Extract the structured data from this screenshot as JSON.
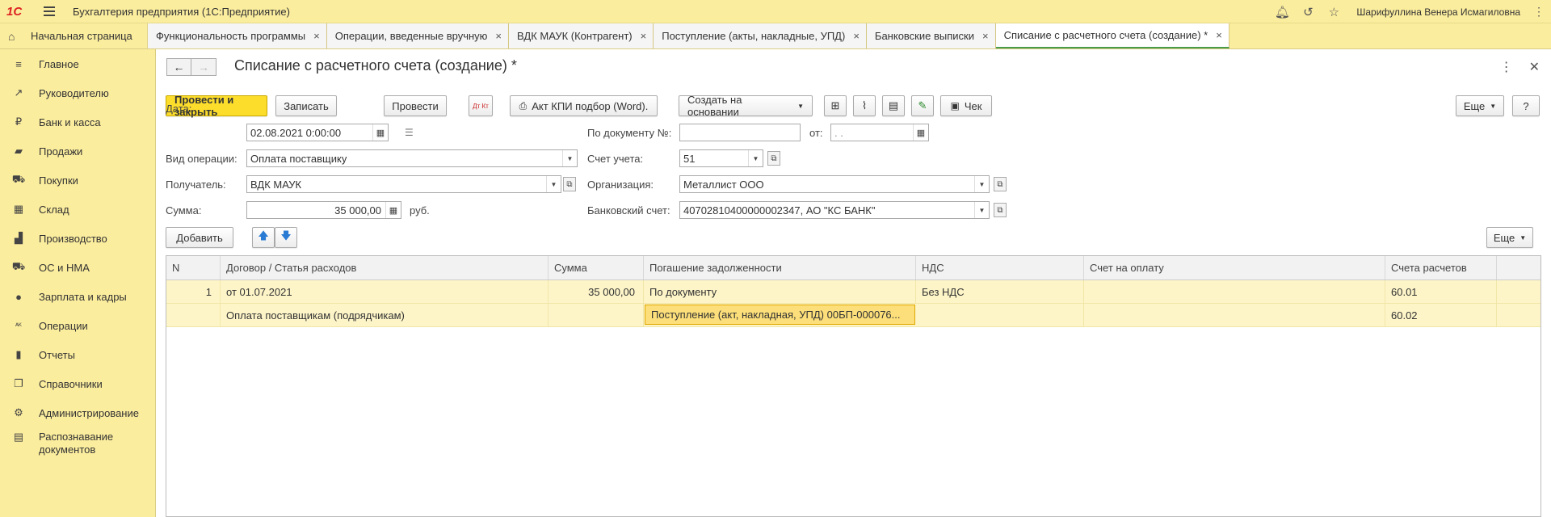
{
  "app": {
    "title": "Бухгалтерия предприятия  (1С:Предприятие)",
    "logo": "1С",
    "user": "Шарифуллина Венера Исмагиловна"
  },
  "tabs": {
    "home": "Начальная страница",
    "items": [
      {
        "label": "Функциональность программы"
      },
      {
        "label": "Операции, введенные вручную"
      },
      {
        "label": "ВДК МАУК (Контрагент)"
      },
      {
        "label": "Поступление (акты, накладные, УПД)"
      },
      {
        "label": "Банковские выписки"
      },
      {
        "label": "Списание с расчетного счета (создание) *"
      }
    ]
  },
  "sidebar": {
    "items": [
      {
        "label": "Главное",
        "icon": "menu-lines-icon"
      },
      {
        "label": "Руководителю",
        "icon": "trend-icon"
      },
      {
        "label": "Банк и касса",
        "icon": "ruble-icon"
      },
      {
        "label": "Продажи",
        "icon": "bag-icon"
      },
      {
        "label": "Покупки",
        "icon": "cart-icon"
      },
      {
        "label": "Склад",
        "icon": "warehouse-icon"
      },
      {
        "label": "Производство",
        "icon": "factory-icon"
      },
      {
        "label": "ОС и НМА",
        "icon": "truck-icon"
      },
      {
        "label": "Зарплата и кадры",
        "icon": "person-icon"
      },
      {
        "label": "Операции",
        "icon": "dt-kt-icon"
      },
      {
        "label": "Отчеты",
        "icon": "bar-chart-icon"
      },
      {
        "label": "Справочники",
        "icon": "books-icon"
      },
      {
        "label": "Администрирование",
        "icon": "gear-icon"
      },
      {
        "label": "Распознавание документов",
        "icon": "scan-icon"
      }
    ]
  },
  "document": {
    "title": "Списание с расчетного счета (создание) *"
  },
  "toolbar": {
    "post_close": "Провести и закрыть",
    "save": "Записать",
    "post": "Провести",
    "dtkt": "Дт Кт",
    "print_act": "Акт КПИ подбор (Word).",
    "create_based": "Создать на основании",
    "check": "Чек",
    "more": "Еще",
    "help": "?"
  },
  "form": {
    "date_label": "Дата:",
    "date_value": "02.08.2021  0:00:00",
    "doc_no_label": "По документу №:",
    "doc_no_value": "",
    "from_label": "от:",
    "from_value": " .  .",
    "op_type_label": "Вид операции:",
    "op_type_value": "Оплата поставщику",
    "account_label": "Счет учета:",
    "account_value": "51",
    "recipient_label": "Получатель:",
    "recipient_value": "ВДК МАУК",
    "org_label": "Организация:",
    "org_value": "Металлист ООО",
    "sum_label": "Сумма:",
    "sum_value": "35 000,00",
    "currency": "руб.",
    "bank_label": "Банковский счет:",
    "bank_value": "40702810400000002347, АО \"КС БАНК\""
  },
  "table_toolbar": {
    "add": "Добавить",
    "more": "Еще"
  },
  "table": {
    "headers": [
      "N",
      "Договор / Статья расходов",
      "Сумма",
      "Погашение задолженности",
      "НДС",
      "Счет на оплату",
      "Счета расчетов"
    ],
    "rows": [
      [
        "1",
        "от 01.07.2021",
        "35 000,00",
        "По документу",
        "Без НДС",
        "",
        "60.01"
      ],
      [
        "",
        "Оплата поставщикам (подрядчикам)",
        "",
        "Поступление (акт, накладная, УПД) 00БП-000076...",
        "",
        "",
        "60.02"
      ]
    ]
  }
}
